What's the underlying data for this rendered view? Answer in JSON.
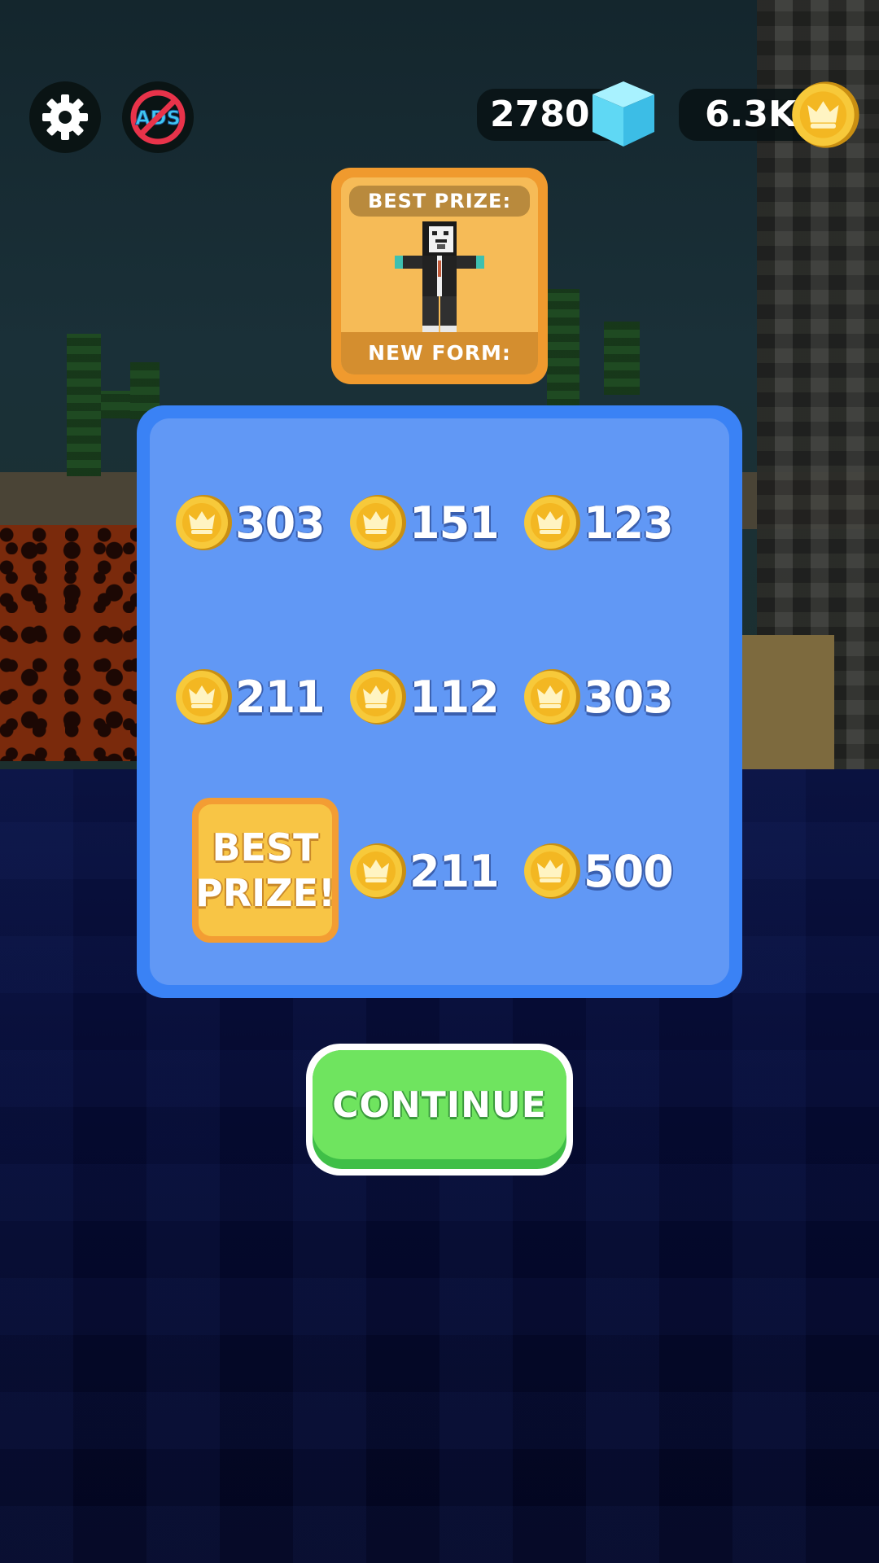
{
  "hud": {
    "cubes_value": "2780",
    "coins_value": "6.3K",
    "settings_icon": "gear-icon",
    "no_ads_icon": "no-ads-icon",
    "no_ads_text": "ADS",
    "cube_icon": "cube-icon",
    "coin_icon": "crown-coin-icon"
  },
  "best_prize_card": {
    "top_label": "BEST PRIZE:",
    "bottom_label": "NEW FORM:",
    "image": "hacker-skin-character"
  },
  "rewards": [
    {
      "value": "303"
    },
    {
      "value": "151"
    },
    {
      "value": "123"
    },
    {
      "value": "211"
    },
    {
      "value": "112"
    },
    {
      "value": "303"
    },
    {
      "value": "211"
    },
    {
      "value": "500"
    }
  ],
  "best_prize_tile": {
    "line1": "BEST",
    "line2": "PRIZE!"
  },
  "continue_button": {
    "label": "CONTINUE"
  },
  "colors": {
    "board": "#3a82f5",
    "board_inner": "#6198f5",
    "coin": "#f4c430",
    "continue": "#6fe45f",
    "prize_card": "#f09a2e"
  }
}
